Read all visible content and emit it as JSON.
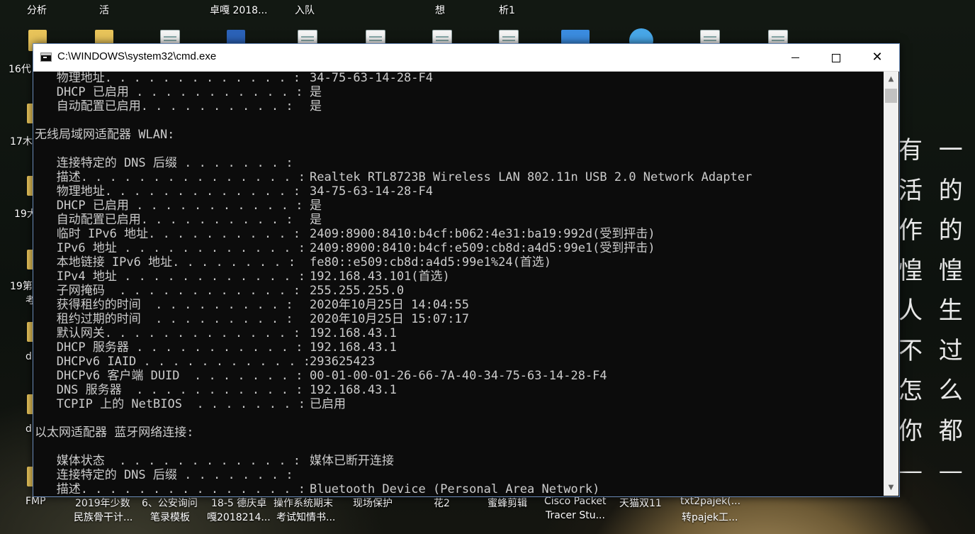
{
  "desktop": {
    "top_labels": [
      "分析",
      "活",
      "卓嘎 2018...",
      "入队",
      "想",
      "析1"
    ],
    "left_labels": [
      "16代",
      "17木",
      "19大",
      "19第",
      "考",
      "d",
      "d"
    ],
    "bottom_labels": [
      {
        "l1": "FMP",
        "l2": ""
      },
      {
        "l1": "2019年少数",
        "l2": "民族骨干计..."
      },
      {
        "l1": "6、公安询问",
        "l2": "笔录模板"
      },
      {
        "l1": "18-5 德庆卓",
        "l2": "嘎2018214..."
      },
      {
        "l1": "操作系统期末",
        "l2": "考试知情书..."
      },
      {
        "l1": "现场保护",
        "l2": ""
      },
      {
        "l1": "花2",
        "l2": ""
      },
      {
        "l1": "蜜蜂剪辑",
        "l2": ""
      },
      {
        "l1": "Cisco Packet",
        "l2": "Tracer Stu..."
      },
      {
        "l1": "天猫双11",
        "l2": ""
      },
      {
        "l1": "txt2pajek(...",
        "l2": "转pajek工..."
      }
    ],
    "wallpaper_text": [
      "有 一 段",
      "活 的",
      "作 的",
      "惶 惶 不",
      "人 生 就",
      "不 过",
      "怎 么",
      "你 都 不",
      "— — —"
    ]
  },
  "window": {
    "title": "C:\\WINDOWS\\system32\\cmd.exe",
    "minimize_label": "minimize",
    "maximize_label": "maximize",
    "close_label": "close"
  },
  "console": {
    "lines": [
      {
        "label": "   物理地址. . . . . . . . . . . . . : ",
        "value": "34-75-63-14-28-F4"
      },
      {
        "label": "   DHCP 已启用 . . . . . . . . . . . : ",
        "value": "是"
      },
      {
        "label": "   自动配置已启用. . . . . . . . . . : ",
        "value": "是"
      },
      {
        "label": "",
        "value": ""
      },
      {
        "label": "无线局域网适配器 WLAN:",
        "value": ""
      },
      {
        "label": "",
        "value": ""
      },
      {
        "label": "   连接特定的 DNS 后缀 . . . . . . . : ",
        "value": ""
      },
      {
        "label": "   描述. . . . . . . . . . . . . . . : ",
        "value": "Realtek RTL8723B Wireless LAN 802.11n USB 2.0 Network Adapter"
      },
      {
        "label": "   物理地址. . . . . . . . . . . . . : ",
        "value": "34-75-63-14-28-F4"
      },
      {
        "label": "   DHCP 已启用 . . . . . . . . . . . : ",
        "value": "是"
      },
      {
        "label": "   自动配置已启用. . . . . . . . . . : ",
        "value": "是"
      },
      {
        "label": "   临时 IPv6 地址. . . . . . . . . . : ",
        "value": "2409:8900:8410:b4cf:b062:4e31:ba19:992d(受到抨击)"
      },
      {
        "label": "   IPv6 地址 . . . . . . . . . . . . : ",
        "value": "2409:8900:8410:b4cf:e509:cb8d:a4d5:99e1(受到抨击)"
      },
      {
        "label": "   本地链接 IPv6 地址. . . . . . . . : ",
        "value": "fe80::e509:cb8d:a4d5:99e1%24(首选)"
      },
      {
        "label": "   IPv4 地址 . . . . . . . . . . . . : ",
        "value": "192.168.43.101(首选)"
      },
      {
        "label": "   子网掩码  . . . . . . . . . . . . : ",
        "value": "255.255.255.0"
      },
      {
        "label": "   获得租约的时间  . . . . . . . . . : ",
        "value": "2020年10月25日 14:04:55"
      },
      {
        "label": "   租约过期的时间  . . . . . . . . . : ",
        "value": "2020年10月25日 15:07:17"
      },
      {
        "label": "   默认网关. . . . . . . . . . . . . : ",
        "value": "192.168.43.1"
      },
      {
        "label": "   DHCP 服务器 . . . . . . . . . . . : ",
        "value": "192.168.43.1"
      },
      {
        "label": "   DHCPv6 IAID . . . . . . . . . . . : ",
        "value": "293625423"
      },
      {
        "label": "   DHCPv6 客户端 DUID  . . . . . . . : ",
        "value": "00-01-00-01-26-66-7A-40-34-75-63-14-28-F4"
      },
      {
        "label": "   DNS 服务器  . . . . . . . . . . . : ",
        "value": "192.168.43.1"
      },
      {
        "label": "   TCPIP 上的 NetBIOS  . . . . . . . : ",
        "value": "已启用"
      },
      {
        "label": "",
        "value": ""
      },
      {
        "label": "以太网适配器 蓝牙网络连接:",
        "value": ""
      },
      {
        "label": "",
        "value": ""
      },
      {
        "label": "   媒体状态  . . . . . . . . . . . . : ",
        "value": "媒体已断开连接"
      },
      {
        "label": "   连接特定的 DNS 后缀 . . . . . . . : ",
        "value": ""
      },
      {
        "label": "   描述. . . . . . . . . . . . . . . : ",
        "value": "Bluetooth Device (Personal Area Network)"
      }
    ]
  },
  "icons": {
    "window_icon": "cmd-icon",
    "minimize": "minimize-icon",
    "maximize": "maximize-icon",
    "close": "close-icon",
    "scroll_up": "chevron-up-icon",
    "scroll_down": "chevron-down-icon"
  }
}
